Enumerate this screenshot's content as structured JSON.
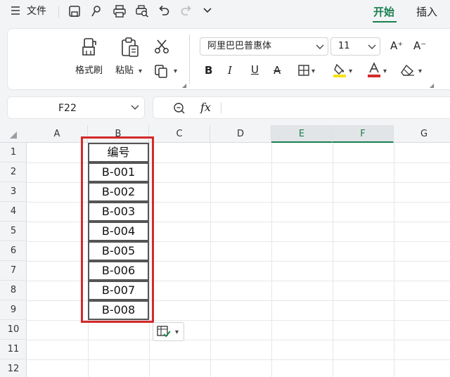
{
  "topbar": {
    "menu_icon": "hamburger-icon",
    "file_label": "文件",
    "quick_access": [
      "save-icon",
      "format-painter-quick-icon",
      "print-icon",
      "print-preview-icon",
      "undo-icon",
      "redo-icon",
      "chevron-down-icon"
    ],
    "tabs": [
      {
        "label": "开始",
        "active": true
      },
      {
        "label": "插入",
        "active": false
      }
    ]
  },
  "ribbon": {
    "format_painter_label": "格式刷",
    "paste_label": "粘贴",
    "font_name": "阿里巴巴普惠体",
    "font_size": "11",
    "bold": "B",
    "italic": "I",
    "underline": "U",
    "strike": "A",
    "grow_font": "A⁺",
    "shrink_font": "A⁻",
    "colors": {
      "fill_highlight": "#f5e21a",
      "font_color": "#d42a2a",
      "accent": "#1a7f4e"
    }
  },
  "formula_bar": {
    "name_box": "F22",
    "fx_label": "fx",
    "content": ""
  },
  "sheet": {
    "columns": [
      "A",
      "B",
      "C",
      "D",
      "E",
      "F",
      "G"
    ],
    "selected_columns": [
      "E",
      "F"
    ],
    "rows": [
      "1",
      "2",
      "3",
      "4",
      "5",
      "6",
      "7",
      "8",
      "9",
      "10",
      "11",
      "12"
    ],
    "column_b": [
      "编号",
      "B-001",
      "B-002",
      "B-003",
      "B-004",
      "B-005",
      "B-006",
      "B-007",
      "B-008"
    ]
  }
}
